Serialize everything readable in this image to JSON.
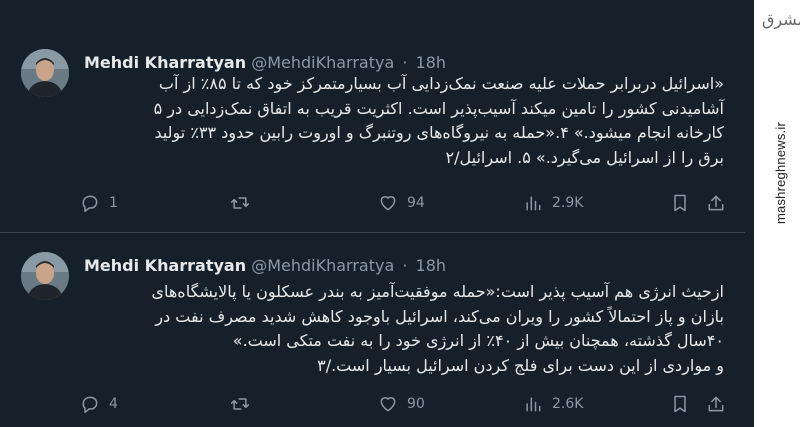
{
  "tweets": [
    {
      "name": "Mehdi Kharratyan",
      "handle": "@MehdiKharratya",
      "dot": "·",
      "time": "18h",
      "text_lines": [
        "«اسرائیل دربرابر حملات علیه صنعت نمک‌زدایی آب بسیارمتمرکز خود که تا ۸۵٪ از آب",
        "آشامیدنی کشور را تامین میکند آسیب‌پذیر است. اکثریت قریب به اتفاق نمک‌زدایی در ۵",
        "کارخانه انجام میشود.» ۴.«حمله به نیروگاه‌های روتنبرگ و اوروت رابین حدود ۳۳٪ تولید",
        "برق را از اسرائیل می‌گیرد.» ۵. اسرائیل/۲"
      ],
      "replies": "1",
      "retweets": "",
      "likes": "94",
      "views": "2.9K"
    },
    {
      "name": "Mehdi Kharratyan",
      "handle": "@MehdiKharratya",
      "dot": "·",
      "time": "18h",
      "text_lines": [
        "ازحیث انرژی هم آسیب پذیر است:«حمله موفقیت‌آمیز به بندر عسکلون یا پالایشگاه‌های",
        "بازان و پاز احتمالاً کشور را ویران می‌کند، اسرائیل باوجود کاهش شدید مصرف نفت در",
        "۴۰سال گذشته، همچنان بیش از ۴۰٪ از انرژی خود را به نفت متکی است.»",
        "و مواردی از این دست برای فلج کردن اسرائیل بسیار است./۳"
      ],
      "replies": "4",
      "retweets": "",
      "likes": "90",
      "views": "2.6K"
    }
  ],
  "watermark": {
    "logo": "مشرق",
    "url": "mashreghnews.ir"
  },
  "icons": {
    "reply": "reply-icon",
    "retweet": "retweet-icon",
    "like": "heart-icon",
    "views": "views-icon",
    "bookmark": "bookmark-icon",
    "share": "share-icon"
  },
  "colors": {
    "background": "#15202b",
    "text": "#e7e9ea",
    "muted": "#8b98a5",
    "divider": "#38444d"
  }
}
